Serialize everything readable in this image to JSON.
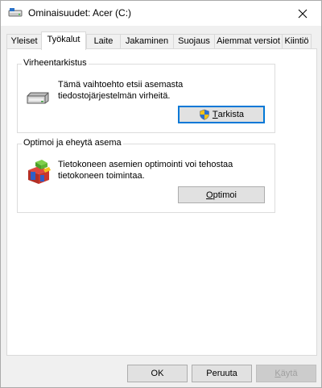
{
  "window": {
    "title": "Ominaisuudet: Acer (C:)",
    "icon": "drive-icon"
  },
  "tabs": [
    {
      "label": "Yleiset",
      "active": false
    },
    {
      "label": "Työkalut",
      "active": true
    },
    {
      "label": "Laite",
      "active": false
    },
    {
      "label": "Jakaminen",
      "active": false
    },
    {
      "label": "Suojaus",
      "active": false
    },
    {
      "label": "Aiemmat versiot",
      "active": false
    },
    {
      "label": "Kiintiö",
      "active": false
    }
  ],
  "error_check": {
    "caption": "Virheentarkistus",
    "description_line1": "Tämä vaihtoehto etsii asemasta",
    "description_line2": "tiedostojärjestelmän virheitä.",
    "button_accel": "T",
    "button_rest": "arkista",
    "button_icon": "uac-shield-icon"
  },
  "optimize": {
    "caption": "Optimoi ja eheytä asema",
    "description_line1": "Tietokoneen asemien optimointi voi tehostaa",
    "description_line2": "tietokoneen toimintaa.",
    "button_accel": "O",
    "button_rest": "ptimoi"
  },
  "footer": {
    "ok_label": "OK",
    "cancel_label": "Peruuta",
    "apply_accel": "K",
    "apply_pre": "",
    "apply_label_full": "Käytä",
    "apply_rest": "äytä"
  },
  "colors": {
    "accent": "#0078d7",
    "window_bg": "#f0f0f0",
    "tab_bg": "#ffffff"
  }
}
